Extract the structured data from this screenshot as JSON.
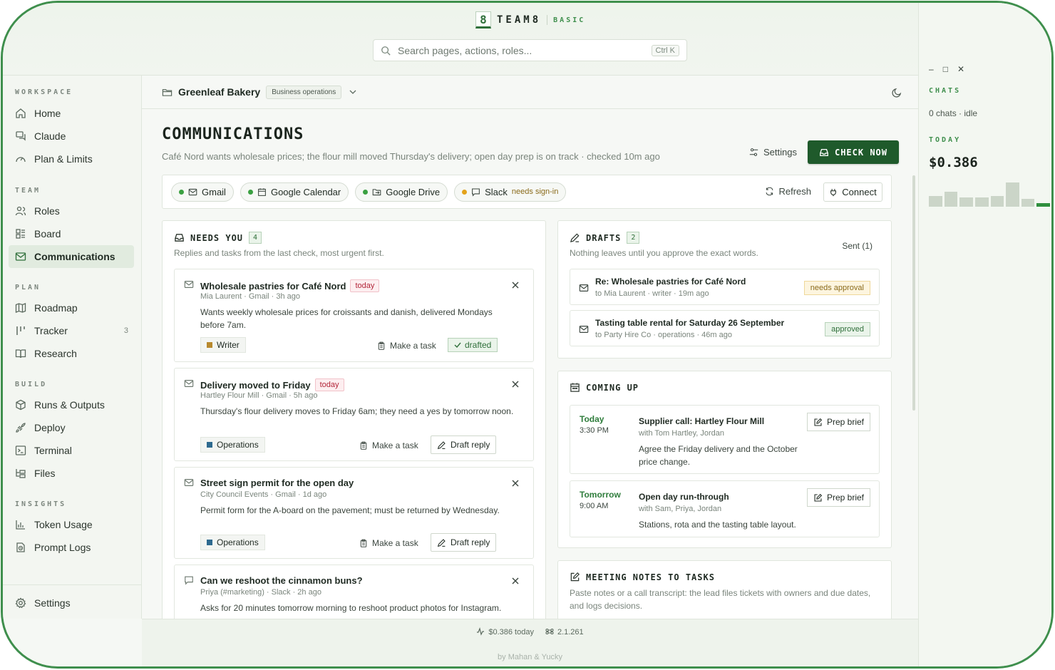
{
  "brand": {
    "mark": "8",
    "name": "TEAM8",
    "tier": "BASIC"
  },
  "search": {
    "placeholder": "Search pages, actions, roles...",
    "shortcut": "Ctrl K"
  },
  "sidebar": {
    "sections": [
      {
        "label": "WORKSPACE",
        "items": [
          {
            "label": "Home",
            "icon": "home-icon"
          },
          {
            "label": "Claude",
            "icon": "chat-icon"
          },
          {
            "label": "Plan & Limits",
            "icon": "gauge-icon"
          }
        ]
      },
      {
        "label": "TEAM",
        "items": [
          {
            "label": "Roles",
            "icon": "users-icon"
          },
          {
            "label": "Board",
            "icon": "board-icon"
          },
          {
            "label": "Communications",
            "icon": "mail-icon",
            "active": true
          }
        ]
      },
      {
        "label": "PLAN",
        "items": [
          {
            "label": "Roadmap",
            "icon": "map-icon"
          },
          {
            "label": "Tracker",
            "icon": "tracker-icon",
            "count": "3"
          },
          {
            "label": "Research",
            "icon": "book-icon"
          }
        ]
      },
      {
        "label": "BUILD",
        "items": [
          {
            "label": "Runs & Outputs",
            "icon": "cube-icon"
          },
          {
            "label": "Deploy",
            "icon": "rocket-icon"
          },
          {
            "label": "Terminal",
            "icon": "terminal-icon"
          },
          {
            "label": "Files",
            "icon": "files-icon"
          }
        ]
      },
      {
        "label": "INSIGHTS",
        "items": [
          {
            "label": "Token Usage",
            "icon": "chart-icon"
          },
          {
            "label": "Prompt Logs",
            "icon": "logs-icon"
          }
        ]
      }
    ],
    "settings_label": "Settings"
  },
  "breadcrumb": {
    "org": "Greenleaf Bakery",
    "tag": "Business operations"
  },
  "page": {
    "title": "COMMUNICATIONS",
    "subtitle": "Café Nord wants wholesale prices; the flour mill moved Thursday's delivery; open day prep is on track · checked 10m ago",
    "settings_label": "Settings",
    "check_now_label": "CHECK NOW"
  },
  "connectors": {
    "items": [
      {
        "label": "Gmail",
        "status": "ok",
        "icon": "mail-icon"
      },
      {
        "label": "Google Calendar",
        "status": "ok",
        "icon": "calendar-icon"
      },
      {
        "label": "Google Drive",
        "status": "ok",
        "icon": "drive-icon"
      },
      {
        "label": "Slack",
        "status": "warn",
        "icon": "slack-icon",
        "note": "needs sign-in"
      }
    ],
    "refresh_label": "Refresh",
    "connect_label": "Connect"
  },
  "needs_you": {
    "title": "NEEDS YOU",
    "count": "4",
    "subtitle": "Replies and tasks from the last check, most urgent first.",
    "items": [
      {
        "subject": "Wholesale pastries for Café Nord",
        "badge": "today",
        "meta": "Mia Laurent · Gmail · 3h ago",
        "body": "Wants weekly wholesale prices for croissants and danish, delivered Mondays before 7am.",
        "role": "Writer",
        "role_color": "#b8892e",
        "task_label": "Make a task",
        "status": "drafted"
      },
      {
        "subject": "Delivery moved to Friday",
        "badge": "today",
        "meta": "Hartley Flour Mill · Gmail · 5h ago",
        "body": "Thursday's flour delivery moves to Friday 6am; they need a yes by tomorrow noon.",
        "role": "Operations",
        "role_color": "#2e6a8f",
        "task_label": "Make a task",
        "action": "Draft reply"
      },
      {
        "subject": "Street sign permit for the open day",
        "badge": "",
        "meta": "City Council Events · Gmail · 1d ago",
        "body": "Permit form for the A-board on the pavement; must be returned by Wednesday.",
        "role": "Operations",
        "role_color": "#2e6a8f",
        "task_label": "Make a task",
        "action": "Draft reply"
      },
      {
        "subject": "Can we reshoot the cinnamon buns?",
        "badge": "",
        "meta": "Priya (#marketing) · Slack · 2h ago",
        "body": "Asks for 20 minutes tomorrow morning to reshoot product photos for Instagram."
      }
    ]
  },
  "drafts": {
    "title": "DRAFTS",
    "count": "2",
    "subtitle": "Nothing leaves until you approve the exact words.",
    "sent_label": "Sent (1)",
    "items": [
      {
        "title": "Re: Wholesale pastries for Café Nord",
        "meta": "to Mia Laurent · writer · 19m ago",
        "status": "needs approval"
      },
      {
        "title": "Tasting table rental for Saturday 26 September",
        "meta": "to Party Hire Co · operations · 46m ago",
        "status": "approved"
      }
    ]
  },
  "coming_up": {
    "title": "COMING UP",
    "events": [
      {
        "day": "Today",
        "time": "3:30 PM",
        "title": "Supplier call: Hartley Flour Mill",
        "with": "with Tom Hartley, Jordan",
        "desc": "Agree the Friday delivery and the October price change.",
        "action": "Prep brief"
      },
      {
        "day": "Tomorrow",
        "time": "9:00 AM",
        "title": "Open day run-through",
        "with": "with Sam, Priya, Jordan",
        "desc": "Stations, rota and the tasting table layout.",
        "action": "Prep brief"
      }
    ]
  },
  "meeting_notes": {
    "title": "MEETING NOTES TO TASKS",
    "subtitle": "Paste notes or a call transcript: the lead files tickets with owners and due dates, and logs decisions."
  },
  "footer": {
    "cost": "$0.386 today",
    "version": "2.1.261",
    "credit": "by Mahan & Yucky"
  },
  "right_panel": {
    "chats_label": "CHATS",
    "chats_status": "0 chats · idle",
    "today_label": "TODAY",
    "today_cost": "$0.386",
    "bars": [
      0.4,
      0.55,
      0.35,
      0.35,
      0.4,
      0.9,
      0.3,
      0.12
    ]
  }
}
